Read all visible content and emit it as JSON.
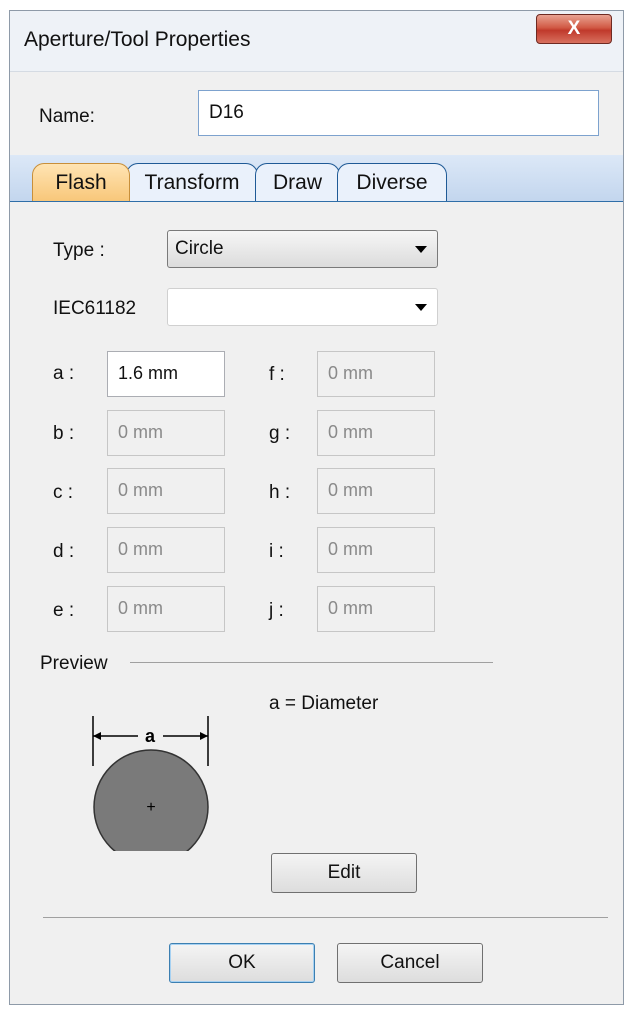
{
  "window": {
    "title": "Aperture/Tool Properties",
    "close_label": "X"
  },
  "name": {
    "label": "Name:",
    "value": "D16"
  },
  "tabs": [
    {
      "label": "Flash",
      "active": true
    },
    {
      "label": "Transform",
      "active": false
    },
    {
      "label": "Draw",
      "active": false
    },
    {
      "label": "Diverse",
      "active": false
    }
  ],
  "type": {
    "label": "Type :",
    "value": "Circle"
  },
  "iec": {
    "label": "IEC61182",
    "value": ""
  },
  "params": {
    "a": {
      "label": "a :",
      "value": "1.6 mm"
    },
    "b": {
      "label": "b :",
      "value": "0 mm"
    },
    "c": {
      "label": "c :",
      "value": "0 mm"
    },
    "d": {
      "label": "d :",
      "value": "0 mm"
    },
    "e": {
      "label": "e :",
      "value": "0 mm"
    },
    "f": {
      "label": "f :",
      "value": "0 mm"
    },
    "g": {
      "label": "g :",
      "value": "0 mm"
    },
    "h": {
      "label": "h :",
      "value": "0 mm"
    },
    "i": {
      "label": "i :",
      "value": "0 mm"
    },
    "j": {
      "label": "j :",
      "value": "0 mm"
    }
  },
  "preview": {
    "label": "Preview",
    "dimension_label": "a",
    "center_mark": "+",
    "description": "a = Diameter",
    "edit_label": "Edit"
  },
  "buttons": {
    "ok": "OK",
    "cancel": "Cancel"
  },
  "colors": {
    "tab_active": "#f8c77a",
    "shape_fill": "#7a7a7a",
    "close": "#c0392b"
  }
}
